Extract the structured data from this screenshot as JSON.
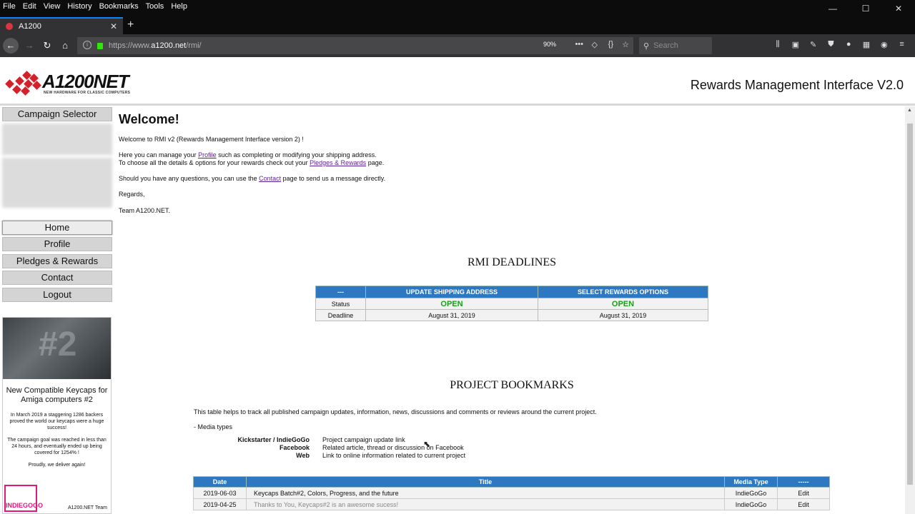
{
  "browser": {
    "menu": [
      "File",
      "Edit",
      "View",
      "History",
      "Bookmarks",
      "Tools",
      "Help"
    ],
    "window_controls": [
      "—",
      "☐",
      "✕"
    ],
    "tab_title": "A1200",
    "tab_close": "✕",
    "new_tab": "+",
    "url_prefix": "https://www.",
    "url_host": "a1200.net",
    "url_path": "/rmi/",
    "zoom": "90%",
    "search_placeholder": "Search",
    "accent": "#0a84ff"
  },
  "site": {
    "logo_name": "A1200NET",
    "logo_tagline": "NEW HARDWARE FOR CLASSIC COMPUTERS",
    "header_title": "Rewards Management Interface V2.0"
  },
  "sidebar": {
    "campaign_selector": "Campaign Selector",
    "items": [
      {
        "label": "Home"
      },
      {
        "label": "Profile"
      },
      {
        "label": "Pledges & Rewards"
      },
      {
        "label": "Contact"
      },
      {
        "label": "Logout"
      }
    ],
    "promo": {
      "title": "New Compatible Keycaps for Amiga computers #2",
      "body1": "In March 2019 a staggering 1286 backers proved the world our keycaps were a huge success!",
      "body2": "The campaign goal was reached in less than 24 hours, and eventually ended up being covered for 1254% !",
      "body3": "Proudly, we deliver again!",
      "badge": "INDIEGOGO",
      "team": "A1200.NET Team"
    }
  },
  "welcome": {
    "heading": "Welcome!",
    "line1": "Welcome to RMI v2 (Rewards Management Interface version 2) !",
    "line2_pre": "Here you can manage your ",
    "line2_link": "Profile",
    "line2_post": " such as completing or modifying your shipping address.",
    "line3_pre": "To choose all the details & options for your rewards check out your ",
    "line3_link": "Pledges & Rewards",
    "line3_post": " page.",
    "line4_pre": "Should you have any questions, you can use the ",
    "line4_link": "Contact",
    "line4_post": " page to send us a message directly.",
    "line5": "Regards,",
    "line6": "Team A1200.NET."
  },
  "deadlines": {
    "heading": "RMI DEADLINES",
    "headers": [
      "---",
      "UPDATE SHIPPING ADDRESS",
      "SELECT REWARDS OPTIONS"
    ],
    "status_label": "Status",
    "status_values": [
      "OPEN",
      "OPEN"
    ],
    "deadline_label": "Deadline",
    "deadline_values": [
      "August 31, 2019",
      "August 31, 2019"
    ],
    "open_color": "#12a312"
  },
  "bookmarks": {
    "heading": "PROJECT BOOKMARKS",
    "intro": "This table helps to track all published campaign updates, information, news, discussions and comments or reviews around the current project.",
    "media_types_label": "- Media types",
    "media_types": [
      {
        "key": "Kickstarter / IndieGoGo",
        "desc": "Project campaign update link"
      },
      {
        "key": "Facebook",
        "desc": "Related article, thread or discussion on Facebook"
      },
      {
        "key": "Web",
        "desc": "Link to online information related to current project"
      }
    ],
    "headers": [
      "Date",
      "Title",
      "Media Type",
      "-----"
    ],
    "rows": [
      {
        "date": "2019-06-03",
        "title": "Keycaps Batch#2, Colors, Progress, and the future",
        "media": "IndieGoGo",
        "action": "Edit"
      },
      {
        "date": "2019-04-25",
        "title": "Thanks to You, Keycaps#2 is an awesome sucess!",
        "media": "IndieGoGo",
        "action": "Edit"
      }
    ],
    "header_color": "#2e77c1"
  }
}
